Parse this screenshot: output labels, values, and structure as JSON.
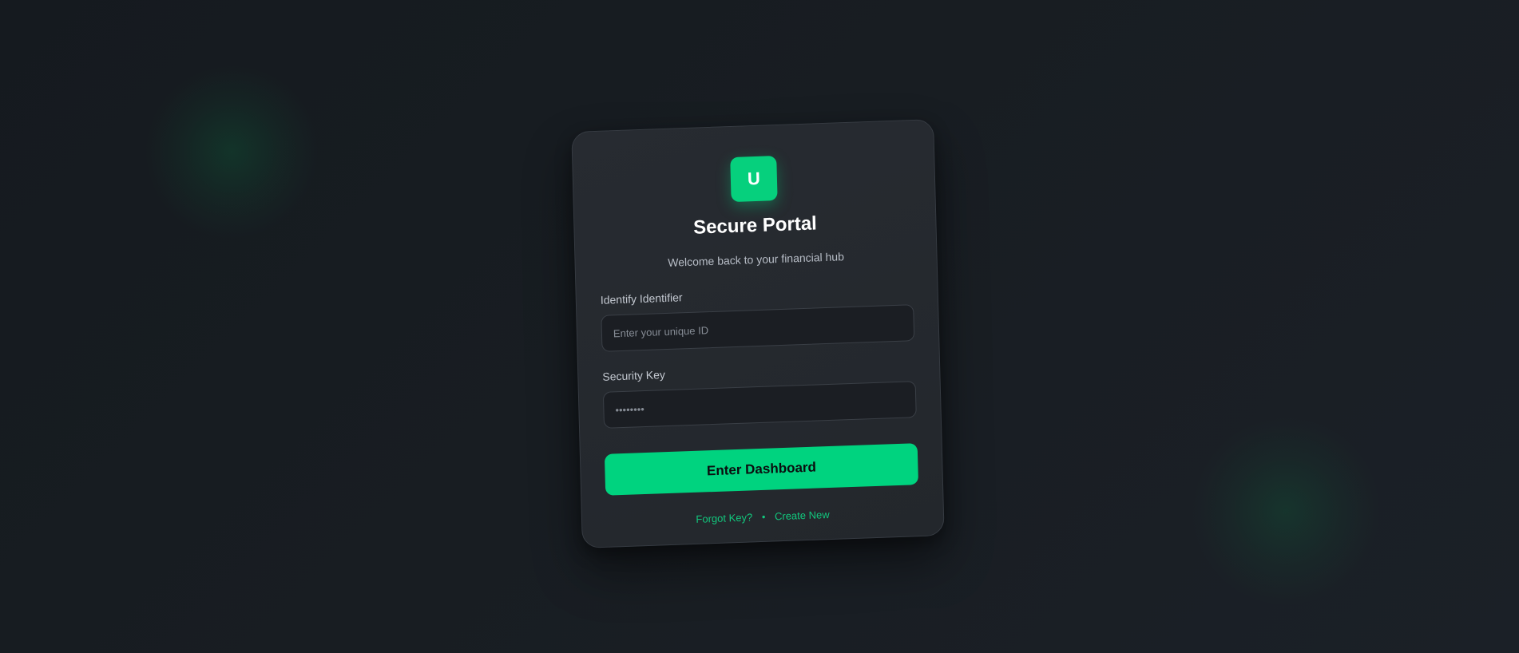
{
  "brand": {
    "logo_letter": "U",
    "accent_color": "#00d37f"
  },
  "header": {
    "title": "Secure Portal",
    "subtitle": "Welcome back to your financial hub"
  },
  "form": {
    "identifier": {
      "label": "Identify Identifier",
      "placeholder": "Enter your unique ID",
      "value": ""
    },
    "security_key": {
      "label": "Security Key",
      "placeholder": "••••••••",
      "value": ""
    },
    "submit_label": "Enter Dashboard"
  },
  "links": {
    "forgot_label": "Forgot Key?",
    "separator": "•",
    "create_label": "Create New"
  }
}
